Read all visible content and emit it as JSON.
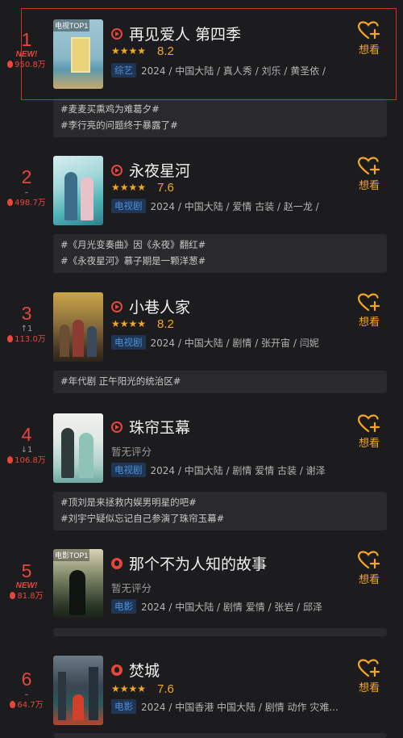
{
  "want_label": "想看",
  "items": [
    {
      "rank": "1",
      "badge": "NEW!",
      "trend": "",
      "heat": "950.8万",
      "poster_tag": "电视TOP1",
      "title": "再见爱人 第四季",
      "title_icon": "play-circle-icon",
      "stars": "★★★★",
      "score": "8.2",
      "no_score": "",
      "genre": "综艺",
      "meta": "2024 / 中国大陆 / 真人秀 / 刘乐 / 黄圣依 /",
      "topics": [
        "#麦麦买熏鸡为难葛夕#",
        "#李行亮的问题终于暴露了#"
      ]
    },
    {
      "rank": "2",
      "badge": "",
      "trend": "–",
      "heat": "498.7万",
      "poster_tag": "",
      "title": "永夜星河",
      "title_icon": "play-circle-icon",
      "stars": "★★★★",
      "score": "7.6",
      "no_score": "",
      "genre": "电视剧",
      "meta": "2024 / 中国大陆 / 爱情 古装 / 赵一龙 /",
      "topics": [
        "#《月光变奏曲》因《永夜》翻红#",
        "#《永夜星河》慕子期是一颗洋葱#"
      ]
    },
    {
      "rank": "3",
      "badge": "",
      "trend": "↑1",
      "heat": "113.0万",
      "poster_tag": "",
      "title": "小巷人家",
      "title_icon": "play-circle-icon",
      "stars": "★★★★",
      "score": "8.2",
      "no_score": "",
      "genre": "电视剧",
      "meta": "2024 / 中国大陆 / 剧情 / 张开宙 / 闫妮",
      "topics": [
        "#年代剧 正午阳光的统治区#"
      ]
    },
    {
      "rank": "4",
      "badge": "",
      "trend": "↓1",
      "heat": "106.8万",
      "poster_tag": "",
      "title": "珠帘玉幕",
      "title_icon": "play-circle-icon",
      "stars": "",
      "score": "",
      "no_score": "暂无评分",
      "genre": "电视剧",
      "meta": "2024 / 中国大陆 / 剧情 爱情 古装 / 谢泽",
      "topics": [
        "#顶刘是来拯救内娱男明星的吧#",
        "#刘宇宁疑似忘记自己参演了珠帘玉幕#"
      ]
    },
    {
      "rank": "5",
      "badge": "NEW!",
      "trend": "",
      "heat": "81.8万",
      "poster_tag": "电影TOP1",
      "title": "那个不为人知的故事",
      "title_icon": "fire-icon",
      "stars": "",
      "score": "",
      "no_score": "暂无评分",
      "genre": "电影",
      "meta": "2024 / 中国大陆 / 剧情 爱情 / 张岩 / 邱泽",
      "topics": []
    },
    {
      "rank": "6",
      "badge": "",
      "trend": "–",
      "heat": "64.7万",
      "poster_tag": "",
      "title": "焚城",
      "title_icon": "fire-icon",
      "stars": "★★★★",
      "score": "7.6",
      "no_score": "",
      "genre": "电影",
      "meta": "2024 / 中国香港 中国大陆 / 剧情 动作 灾难...",
      "topics": []
    }
  ]
}
